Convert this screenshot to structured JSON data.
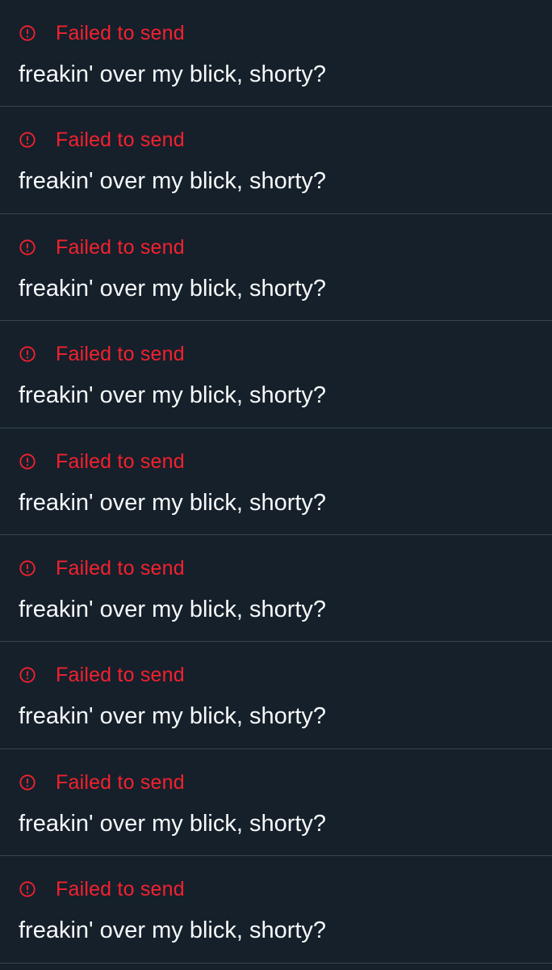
{
  "colors": {
    "background": "#15202b",
    "divider": "#38444d",
    "error": "#f4212e",
    "message_text": "#f7f9f9"
  },
  "messages": [
    {
      "status_icon": "alert-circle-icon",
      "status": "Failed to send",
      "text": "freakin' over my blick, shorty?"
    },
    {
      "status_icon": "alert-circle-icon",
      "status": "Failed to send",
      "text": "freakin' over my blick, shorty?"
    },
    {
      "status_icon": "alert-circle-icon",
      "status": "Failed to send",
      "text": "freakin' over my blick, shorty?"
    },
    {
      "status_icon": "alert-circle-icon",
      "status": "Failed to send",
      "text": "freakin' over my blick, shorty?"
    },
    {
      "status_icon": "alert-circle-icon",
      "status": "Failed to send",
      "text": "freakin' over my blick, shorty?"
    },
    {
      "status_icon": "alert-circle-icon",
      "status": "Failed to send",
      "text": "freakin' over my blick, shorty?"
    },
    {
      "status_icon": "alert-circle-icon",
      "status": "Failed to send",
      "text": "freakin' over my blick, shorty?"
    },
    {
      "status_icon": "alert-circle-icon",
      "status": "Failed to send",
      "text": "freakin' over my blick, shorty?"
    },
    {
      "status_icon": "alert-circle-icon",
      "status": "Failed to send",
      "text": "freakin' over my blick, shorty?"
    }
  ]
}
